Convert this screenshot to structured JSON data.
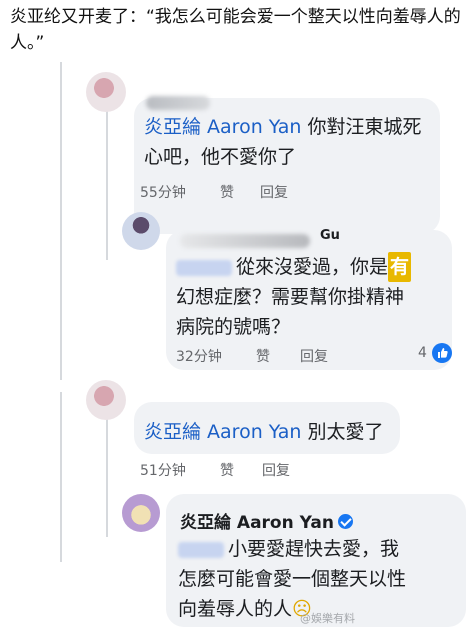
{
  "caption": "炎亚纶又开麦了：“我怎么可能会爱一个整天以性向羞辱人的人。”",
  "comments": [
    {
      "mention": "炎亞綸 Aaron Yan",
      "line1_rest": " 你對汪東城死",
      "line2": "心吧，他不愛你了",
      "time": "55分钟",
      "like": "赞",
      "reply": "回复"
    },
    {
      "author_partial": "Gu",
      "line1": "從來沒愛過，你是",
      "badge": "有",
      "line2": "幻想症麼？需要幫你掛精神",
      "line3": "病院的號嗎？",
      "time": "32分钟",
      "like": "赞",
      "reply": "回复",
      "reactions": "4"
    },
    {
      "mention": "炎亞綸 Aaron Yan",
      "line1_rest": " 別太愛了",
      "time": "51分钟",
      "like": "赞",
      "reply": "回复"
    },
    {
      "author": "炎亞綸 Aaron Yan",
      "line1": "小要愛趕快去愛，我",
      "line2": "怎麼可能會愛一個整天以性",
      "line3": "向羞辱人的人",
      "emoji": "☹"
    }
  ],
  "watermark": "@娛樂有料"
}
